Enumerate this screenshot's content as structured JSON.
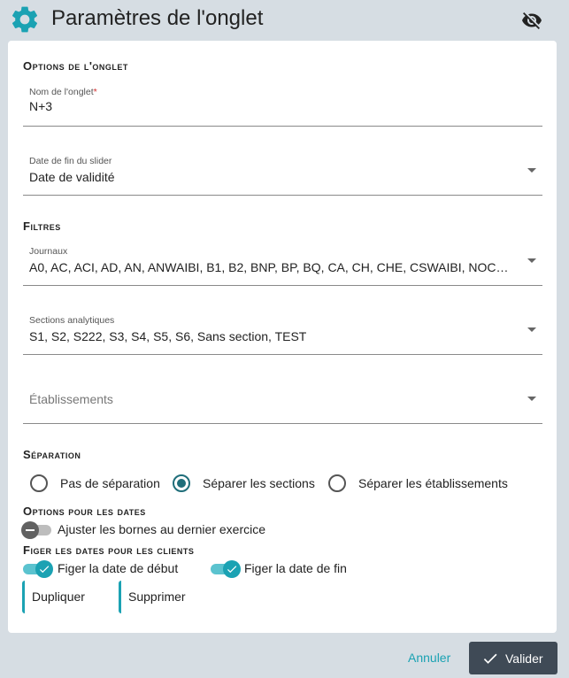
{
  "header": {
    "title": "Paramètres de l'onglet",
    "icon": "gear-icon",
    "visibility_icon": "eye-off-icon",
    "accent_color": "#1ba2b3"
  },
  "options": {
    "section_title": "Options de l'onglet",
    "tab_name": {
      "label": "Nom de l'onglet",
      "required_mark": "*",
      "value": "N+3"
    },
    "slider_end_date": {
      "label": "Date de fin du slider",
      "value": "Date de validité"
    }
  },
  "filters": {
    "section_title": "Filtres",
    "journals": {
      "label": "Journaux",
      "value": "A0, AC, ACI, AD, AN, ANWAIBI, B1, B2, BNP, BP, BQ, CA, CH, CHE, CSWAIBI, NOCO…"
    },
    "analytic_sections": {
      "label": "Sections analytiques",
      "value": "S1, S2, S222, S3, S4, S5, S6, Sans section, TEST"
    },
    "establishments": {
      "placeholder": "Établissements"
    }
  },
  "separation": {
    "section_title": "Séparation",
    "options": [
      {
        "label": "Pas de séparation",
        "checked": false
      },
      {
        "label": "Séparer les sections",
        "checked": true
      },
      {
        "label": "Séparer les établissements",
        "checked": false
      }
    ]
  },
  "date_options": {
    "section_title": "Options pour les dates",
    "adjust_bounds": {
      "label": "Ajuster les bornes au dernier exercice",
      "on": false
    }
  },
  "client_dates": {
    "section_title": "Figer les dates pour les clients",
    "freeze_start": {
      "label": "Figer la date de début",
      "on": true
    },
    "freeze_end": {
      "label": "Figer la date de fin",
      "on": true
    }
  },
  "actions": {
    "duplicate": "Dupliquer",
    "delete": "Supprimer"
  },
  "footer": {
    "cancel": "Annuler",
    "validate": "Valider"
  }
}
